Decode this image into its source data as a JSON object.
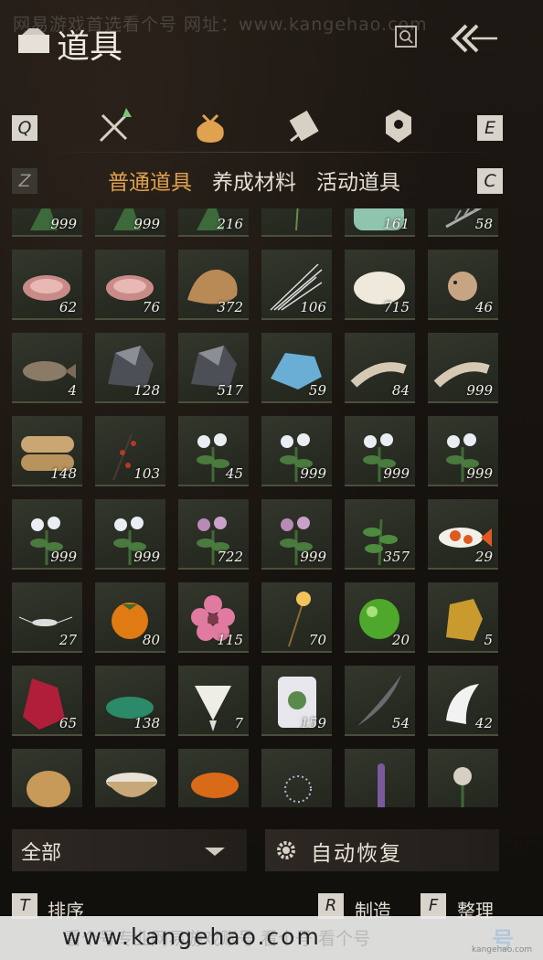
{
  "header": {
    "watermark": "网易游戏首选看个号   网址：www.kangehao.com",
    "title": "道具"
  },
  "category_keys": {
    "prev": "Q",
    "next": "E"
  },
  "category_icons": [
    "weapon-icon",
    "bag-icon",
    "scroll-icon",
    "badge-icon"
  ],
  "subtab_keys": {
    "prev": "Z",
    "next": "C"
  },
  "subtabs": [
    "普通道具",
    "养成材料",
    "活动道具"
  ],
  "active_subtab": "普通道具",
  "items": [
    {
      "icon": "herb-icon",
      "count": "999"
    },
    {
      "icon": "herb-icon",
      "count": "999"
    },
    {
      "icon": "herb-icon",
      "count": "216"
    },
    {
      "icon": "grass-icon",
      "count": ""
    },
    {
      "icon": "jade-icon",
      "count": "161"
    },
    {
      "icon": "fern-icon",
      "count": "58"
    },
    {
      "icon": "meat-icon",
      "count": "62"
    },
    {
      "icon": "meat-icon",
      "count": "76"
    },
    {
      "icon": "fur-icon",
      "count": "372"
    },
    {
      "icon": "quills-icon",
      "count": "106"
    },
    {
      "icon": "wool-icon",
      "count": "715"
    },
    {
      "icon": "pufferfish-icon",
      "count": "46"
    },
    {
      "icon": "fish-icon",
      "count": "4"
    },
    {
      "icon": "ore-icon",
      "count": "128"
    },
    {
      "icon": "ore-icon",
      "count": "517"
    },
    {
      "icon": "crystal-icon",
      "count": "59"
    },
    {
      "icon": "bone-icon",
      "count": "84"
    },
    {
      "icon": "bone-icon",
      "count": "999"
    },
    {
      "icon": "sack-icon",
      "count": "148"
    },
    {
      "icon": "berry-branch-icon",
      "count": "103"
    },
    {
      "icon": "white-flower-icon",
      "count": "45"
    },
    {
      "icon": "white-flower-icon",
      "count": "999"
    },
    {
      "icon": "white-flower-icon",
      "count": "999"
    },
    {
      "icon": "white-flower-icon",
      "count": "999"
    },
    {
      "icon": "white-flower-icon",
      "count": "999"
    },
    {
      "icon": "white-flower-icon",
      "count": "999"
    },
    {
      "icon": "purple-flower-icon",
      "count": "722"
    },
    {
      "icon": "purple-flower-icon",
      "count": "999"
    },
    {
      "icon": "herb-sprig-icon",
      "count": "357"
    },
    {
      "icon": "koi-icon",
      "count": "29"
    },
    {
      "icon": "insect-icon",
      "count": "27"
    },
    {
      "icon": "persimmon-icon",
      "count": "80"
    },
    {
      "icon": "pink-flower-icon",
      "count": "115"
    },
    {
      "icon": "sparkler-icon",
      "count": "70"
    },
    {
      "icon": "green-orb-icon",
      "count": "20"
    },
    {
      "icon": "gold-ore-icon",
      "count": "5"
    },
    {
      "icon": "red-crystal-icon",
      "count": "65"
    },
    {
      "icon": "green-gravel-icon",
      "count": "138"
    },
    {
      "icon": "white-bloom-icon",
      "count": "7"
    },
    {
      "icon": "jar-icon",
      "count": "159"
    },
    {
      "icon": "feather-icon",
      "count": "54"
    },
    {
      "icon": "white-fur-icon",
      "count": "42"
    },
    {
      "icon": "shell-icon",
      "count": ""
    },
    {
      "icon": "bowl-icon",
      "count": ""
    },
    {
      "icon": "amber-icon",
      "count": ""
    },
    {
      "icon": "spider-lily-icon",
      "count": ""
    },
    {
      "icon": "lavender-icon",
      "count": ""
    },
    {
      "icon": "rose-icon",
      "count": ""
    }
  ],
  "filter": {
    "label": "全部"
  },
  "auto_restore": {
    "label": "自动恢复"
  },
  "hints": [
    {
      "key": "T",
      "label": "排序"
    },
    {
      "key": "R",
      "label": "制造"
    },
    {
      "key": "F",
      "label": "整理"
    }
  ],
  "banner": {
    "faint_text": "看个号专业网易游戏账号    看个号  看个号",
    "url": "www.kangehao.com",
    "logo": "号",
    "tag": "kangehao.com"
  }
}
